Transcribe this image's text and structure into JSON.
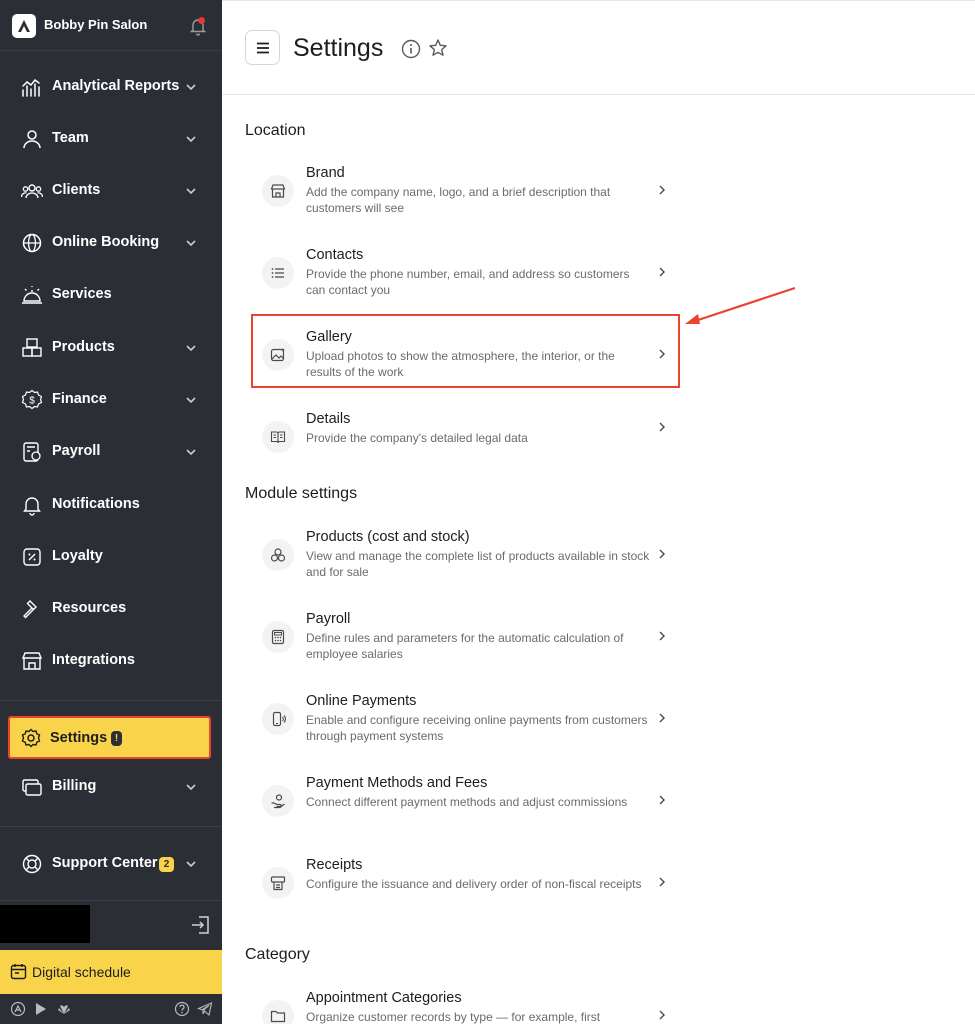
{
  "sidebar": {
    "brand_name": "Bobby Pin Salon",
    "items": [
      {
        "label": "Analytical Reports",
        "icon": "analytics-icon",
        "has_chevron": true
      },
      {
        "label": "Team",
        "icon": "person-icon",
        "has_chevron": true
      },
      {
        "label": "Clients",
        "icon": "clients-icon",
        "has_chevron": true
      },
      {
        "label": "Online Booking",
        "icon": "globe-icon",
        "has_chevron": true
      },
      {
        "label": "Services",
        "icon": "service-bell-icon",
        "has_chevron": false
      },
      {
        "label": "Products",
        "icon": "boxes-icon",
        "has_chevron": true
      },
      {
        "label": "Finance",
        "icon": "dollar-icon",
        "has_chevron": true
      },
      {
        "label": "Payroll",
        "icon": "payroll-icon",
        "has_chevron": true
      },
      {
        "label": "Notifications",
        "icon": "bell-icon",
        "has_chevron": false
      },
      {
        "label": "Loyalty",
        "icon": "percent-icon",
        "has_chevron": false
      },
      {
        "label": "Resources",
        "icon": "hammer-icon",
        "has_chevron": false
      },
      {
        "label": "Integrations",
        "icon": "store-icon",
        "has_chevron": false
      }
    ],
    "settings": {
      "label": "Settings",
      "badge": "!"
    },
    "billing": {
      "label": "Billing"
    },
    "support": {
      "label": "Support Center",
      "badge": "2"
    },
    "digital_schedule": "Digital schedule"
  },
  "header": {
    "title": "Settings"
  },
  "sections": [
    {
      "title": "Location",
      "rows": [
        {
          "title": "Brand",
          "desc": "Add the company name, logo, and a brief description that customers will see",
          "icon": "store-icon"
        },
        {
          "title": "Contacts",
          "desc": "Provide the phone number, email, and address so customers can contact you",
          "icon": "list-icon"
        },
        {
          "title": "Gallery",
          "desc": "Upload photos to show the atmosphere, the interior, or the results of the work",
          "icon": "gallery-icon"
        },
        {
          "title": "Details",
          "desc": "Provide the company's detailed legal data",
          "icon": "book-icon"
        }
      ]
    },
    {
      "title": "Module settings",
      "rows": [
        {
          "title": "Products (cost and stock)",
          "desc": "View and manage the complete list of products available in stock and for sale",
          "icon": "products-icon"
        },
        {
          "title": "Payroll",
          "desc": "Define rules and parameters for the automatic calculation of employee salaries",
          "icon": "calculator-icon"
        },
        {
          "title": "Online Payments",
          "desc": "Enable and configure receiving online payments from customers through payment systems",
          "icon": "phone-pay-icon"
        },
        {
          "title": "Payment Methods and Fees",
          "desc": "Connect different payment methods and adjust commissions",
          "icon": "hand-coin-icon"
        },
        {
          "title": "Receipts",
          "desc": "Configure the issuance and delivery order of non-fiscal receipts",
          "icon": "receipt-icon"
        }
      ]
    },
    {
      "title": "Category",
      "rows": [
        {
          "title": "Appointment Categories",
          "desc": "Organize customer records by type — for example, first",
          "icon": "folder-icon"
        }
      ]
    }
  ]
}
